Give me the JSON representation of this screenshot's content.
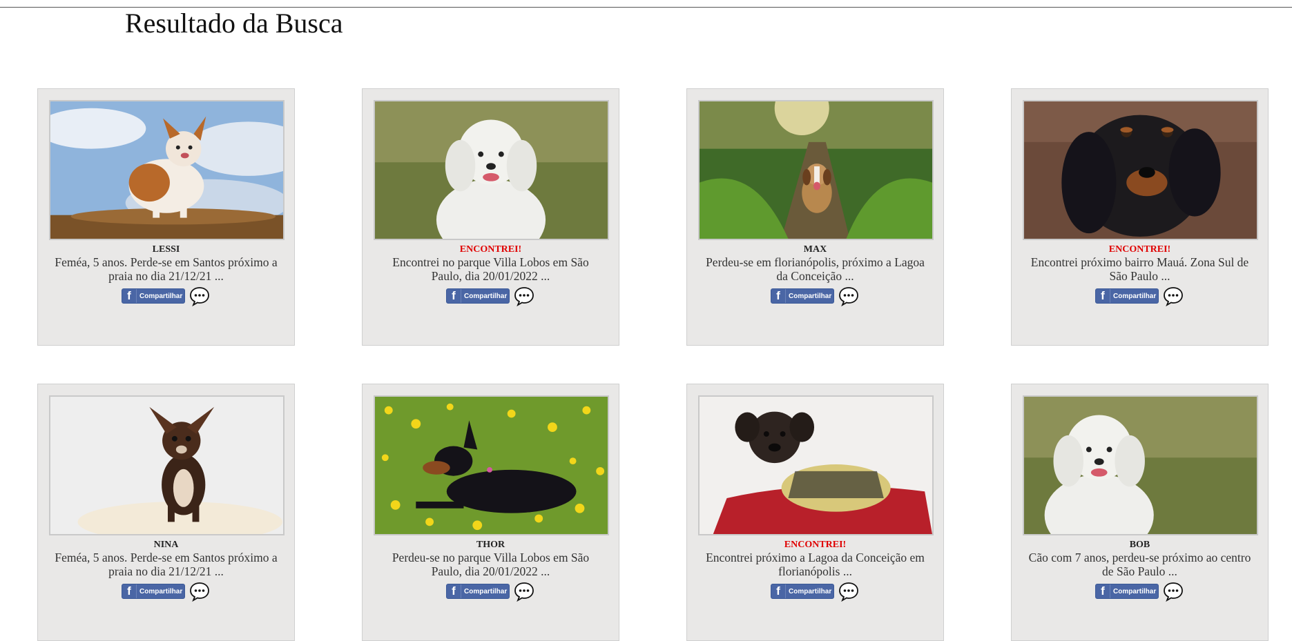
{
  "page": {
    "title": "Resultado da Busca"
  },
  "cards": [
    {
      "name": "LESSI",
      "found": false,
      "description": "Feméa, 5 anos. Perde-se em Santos próximo a praia no dia 21/12/21 ...",
      "share_label": "Compartilhar",
      "image": "chihuahua-longhair-sky"
    },
    {
      "name": "ENCONTREI!",
      "found": true,
      "description": "Encontrei no parque Villa Lobos em São Paulo, dia 20/01/2022 ...",
      "share_label": "Compartilhar",
      "image": "white-poodle-grass"
    },
    {
      "name": "MAX",
      "found": false,
      "description": "Perdeu-se em florianópolis, próximo a Lagoa da Conceição ...",
      "share_label": "Compartilhar",
      "image": "beagle-path"
    },
    {
      "name": "ENCONTREI!",
      "found": true,
      "description": "Encontrei próximo bairro Mauá. Zona Sul de São Paulo ...",
      "share_label": "Compartilhar",
      "image": "black-tan-dog"
    },
    {
      "name": "NINA",
      "found": false,
      "description": "Feméa, 5 anos. Perde-se em Santos próximo a praia no dia 21/12/21 ...",
      "share_label": "Compartilhar",
      "image": "chihuahua-white-bg"
    },
    {
      "name": "THOR",
      "found": false,
      "description": "Perdeu-se no parque Villa Lobos em São Paulo, dia 20/01/2022 ...",
      "share_label": "Compartilhar",
      "image": "doberman-flowers"
    },
    {
      "name": "ENCONTREI!",
      "found": true,
      "description": "Encontrei próximo a Lagoa da Conceição em florianópolis ...",
      "share_label": "Compartilhar",
      "image": "puppy-sweater"
    },
    {
      "name": "BOB",
      "found": false,
      "description": "Cão com 7 anos, perdeu-se próximo ao centro de São Paulo ...",
      "share_label": "Compartilhar",
      "image": "white-poodle-grass"
    }
  ],
  "colors": {
    "found": "#e00000",
    "facebook": "#4a66a5",
    "card_bg": "#e9e8e7"
  }
}
